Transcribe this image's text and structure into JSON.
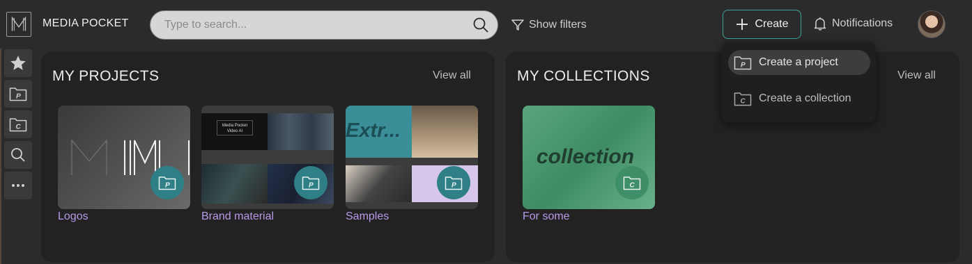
{
  "app": {
    "title": "MEDIA POCKET"
  },
  "search": {
    "placeholder": "Type to search..."
  },
  "toolbar": {
    "filters_label": "Show filters",
    "create_label": "Create",
    "notifications_label": "Notifications"
  },
  "rail": {
    "items": [
      {
        "icon": "star-icon"
      },
      {
        "icon": "project-folder-icon"
      },
      {
        "icon": "collection-folder-icon"
      },
      {
        "icon": "search-icon"
      },
      {
        "icon": "more-icon"
      }
    ]
  },
  "projects": {
    "title": "MY PROJECTS",
    "view_all": "View all",
    "items": [
      {
        "label": "Logos"
      },
      {
        "label": "Brand material",
        "thumb_text": "Media Pocket\nVideo AI"
      },
      {
        "label": "Samples",
        "thumb_text": "Extr..."
      }
    ]
  },
  "collections": {
    "title": "MY COLLECTIONS",
    "view_all": "View all",
    "items": [
      {
        "label": "For some",
        "thumb_text": "collection"
      }
    ]
  },
  "create_menu": {
    "items": [
      {
        "label": "Create a project",
        "icon": "project-folder-icon"
      },
      {
        "label": "Create a collection",
        "icon": "collection-folder-icon"
      }
    ]
  },
  "colors": {
    "accent": "#3aa99a",
    "link": "#b79ae8",
    "project_badge": "#2f7f86",
    "collection_badge": "#3e8e68"
  }
}
